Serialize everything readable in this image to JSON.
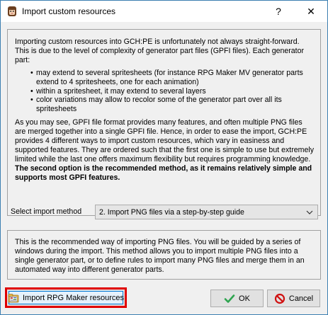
{
  "window": {
    "title": "Import custom resources",
    "help_glyph": "?",
    "close_glyph": "✕"
  },
  "intro": {
    "p1": "Importing custom resources into GCH:PE is unfortunately not always straight-forward. This is due to the level of complexity of generator part files (GPFI files). Each generator part:",
    "bullets": [
      "may extend to several spritesheets (for instance RPG Maker MV generator parts extend to 4 spritesheets, one for each animation)",
      "within a spritesheet, it may extend to several layers",
      "color variations may allow to recolor some of the generator part over all its spritesheets"
    ],
    "p2": "As you may see, GPFI file format provides many features, and often multiple PNG files are merged together into a single GPFI file. Hence, in order to ease the import, GCH:PE provides 4 different ways to import custom resources, which vary in easiness and supported features. They are ordered such that the first one is simple to use but extremely limited while the last one offers maximum flexibility but requires programming knowledge.",
    "p2_bold": "The second option is the recommended method, as it remains relatively simple and supports most GPFI features."
  },
  "method": {
    "label": "Select import method",
    "selected": "2. Import PNG files via a step-by-step guide"
  },
  "description": "This is the recommended way of importing PNG files. You will be guided by a series of windows during the import. This method allows you to import multiple PNG files into a single generator part, or to define rules to import many PNG files and merge them in an automated way into different generator parts.",
  "buttons": {
    "import_rpg": "Import RPG Maker resources",
    "ok": "OK",
    "cancel": "Cancel"
  },
  "icons": {
    "app": "character-face-icon",
    "import": "folder-import-icon",
    "ok": "checkmark-icon",
    "cancel": "no-sign-icon"
  },
  "colors": {
    "title_border": "#3c7fb1",
    "highlight_red": "#e00000",
    "focus_blue": "#0078d7",
    "ok_green": "#2ea44f",
    "cancel_red": "#d01010"
  }
}
